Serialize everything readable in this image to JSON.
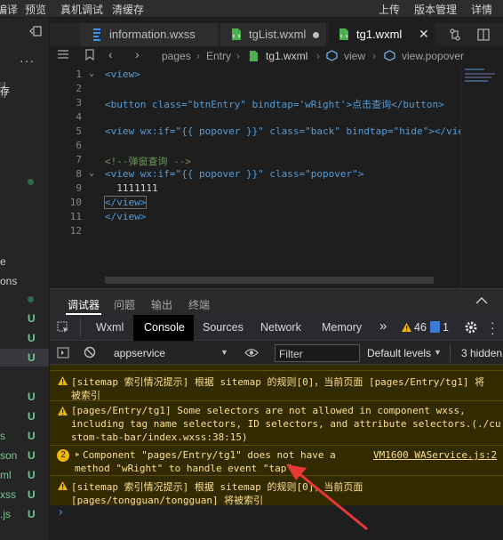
{
  "toolbar": {
    "compile": "编译",
    "preview": "预览",
    "real_debug": "真机调试",
    "clear_cache": "清缓存",
    "upload": "上传",
    "version_mgmt": "版本管理",
    "details": "详情"
  },
  "left_panel": {
    "cut_label": "存",
    "items": [
      {
        "label": "e",
        "status": ""
      },
      {
        "label": "ons",
        "status": ""
      },
      {
        "label": "",
        "status": "U"
      },
      {
        "label": "",
        "status": "U"
      },
      {
        "label": "",
        "status": "U"
      },
      {
        "label": "",
        "status": "U"
      },
      {
        "label": "",
        "status": "U"
      },
      {
        "label": "s",
        "status": "U"
      },
      {
        "label": "son",
        "status": "U"
      },
      {
        "label": "ml",
        "status": "U"
      },
      {
        "label": "xss",
        "status": "U"
      },
      {
        "label": ".js",
        "status": "U"
      }
    ]
  },
  "tabs": [
    {
      "label": "information.wxss",
      "active": false
    },
    {
      "label": "tgList.wxml",
      "active": false
    },
    {
      "label": "tg1.wxml",
      "active": true
    }
  ],
  "breadcrumb": [
    "pages",
    "Entry",
    "tg1.wxml",
    "view",
    "view.popover"
  ],
  "code": {
    "line_numbers": [
      "1",
      "2",
      "3",
      "4",
      "5",
      "6",
      "7",
      "8",
      "9",
      "10",
      "11",
      "12"
    ],
    "lines": [
      "<view>",
      "",
      "<button class=\"btnEntry\" bindtap='wRight'>点击查询</button>",
      "",
      "<view wx:if=\"{{ popover }}\" class=\"back\" bindtap=\"hide\"></view>",
      "",
      "<!--弹窗查询 -->",
      "<view wx:if=\"{{ popover }}\" class=\"popover\">",
      "  1111111",
      "</view>",
      "</view>",
      ""
    ]
  },
  "devtools": {
    "top_tabs": [
      "调试器",
      "问题",
      "输出",
      "终端"
    ],
    "panel_tabs": [
      "Wxml",
      "Console",
      "Sources",
      "Network",
      "Memory"
    ],
    "more": "»",
    "warn_count": "46",
    "error_count": "1",
    "context": "appservice",
    "filter_placeholder": "Filter",
    "levels": "Default levels",
    "hidden": "3 hidden"
  },
  "console_messages": [
    {
      "lines": [
        "[sitemap 索引情况提示] 根据 sitemap 的规则[0]，当前页面 [pages/Entry/tg1] 将",
        "被索引"
      ]
    },
    {
      "lines": [
        "[pages/Entry/tg1] Some selectors are not allowed in component wxss,",
        "including tag name selectors, ID selectors, and attribute selectors.(./cu",
        "stom-tab-bar/index.wxss:38:15)"
      ]
    },
    {
      "lines": [
        "Component \"pages/Entry/tg1\" does not have a",
        "method \"wRight\" to handle event \"tap\"."
      ],
      "source": "VM1600 WAService.js:2",
      "badge": "2"
    },
    {
      "lines": [
        "[sitemap 索引情况提示] 根据 sitemap 的规则[0]，当前页面",
        "[pages/tongguan/tongguan] 将被索引"
      ]
    }
  ],
  "prompt": "›",
  "colors": {
    "accent": "#3794ff",
    "tag": "#569cd6",
    "attr": "#9cdcfe",
    "string": "#ce9178",
    "comment": "#6a9955",
    "warning_bg": "#332b00",
    "warning_text": "#fddf95",
    "arrow": "#e53935"
  }
}
